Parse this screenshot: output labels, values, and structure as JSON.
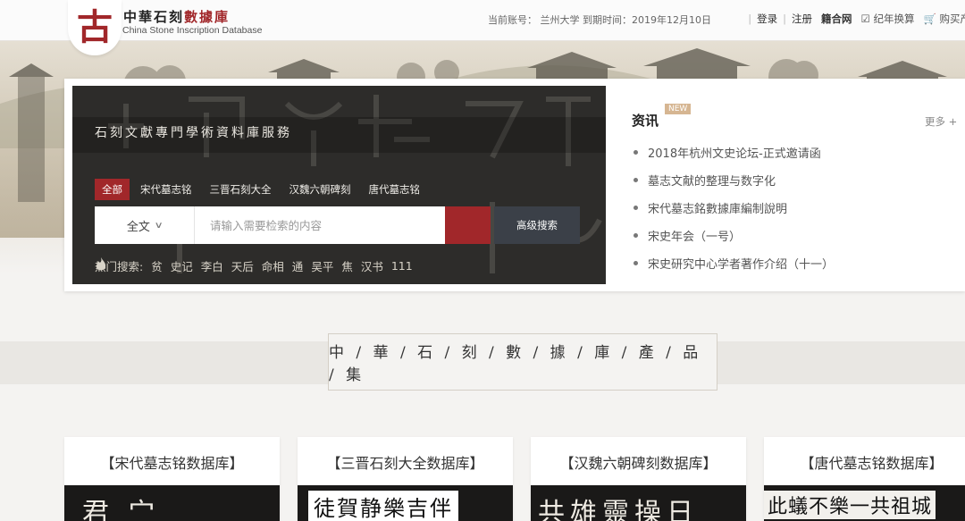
{
  "header": {
    "logo_glyph": "古",
    "title_black": "中華石刻",
    "title_red": "數據庫",
    "subtitle": "China Stone Inscription Database",
    "account": "当前账号： 兰州大学 到期时间：2019年12月10日",
    "links": {
      "login": "登录",
      "register": "注册",
      "jihe": "籍合网",
      "calendar": "纪年换算",
      "buy": "购买产"
    }
  },
  "search": {
    "service_title": "石刻文獻專門學術資料庫服務",
    "tabs": [
      "全部",
      "宋代墓志铭",
      "三晋石刻大全",
      "汉魏六朝碑刻",
      "唐代墓志铭"
    ],
    "active_tab": 0,
    "scope": "全文",
    "placeholder": "请输入需要检索的内容",
    "advanced": "高级搜索",
    "hot_label": "热门搜索:",
    "hot_terms": [
      "贫",
      "史记",
      "李白",
      "天后",
      "命相",
      "通",
      "吴平",
      "焦",
      "汉书",
      "111"
    ]
  },
  "news": {
    "title": "资讯",
    "badge": "NEW",
    "more": "更多 +",
    "items": [
      "2018年杭州文史论坛-正式邀请函",
      "墓志文献的整理与数字化",
      "宋代墓志銘數據庫編制說明",
      "宋史年会（一号）",
      "宋史研究中心学者著作介绍（十一）"
    ]
  },
  "products": {
    "heading": "中 / 華 / 石 / 刻 / 數 / 據 / 庫 / 產 / 品 / 集",
    "cards": [
      {
        "title": "【宋代墓志铭数据库】",
        "glyphs": "君 宀"
      },
      {
        "title": "【三晋石刻大全数据库】",
        "glyphs": "徒賀静樂吉伴"
      },
      {
        "title": "【汉魏六朝碑刻数据库】",
        "glyphs": "共雄靈操日"
      },
      {
        "title": "【唐代墓志铭数据库】",
        "glyphs": "此蟻不樂一共祖城"
      }
    ]
  },
  "colors": {
    "accent_red": "#a1272a",
    "dark_button": "#3b4048"
  }
}
